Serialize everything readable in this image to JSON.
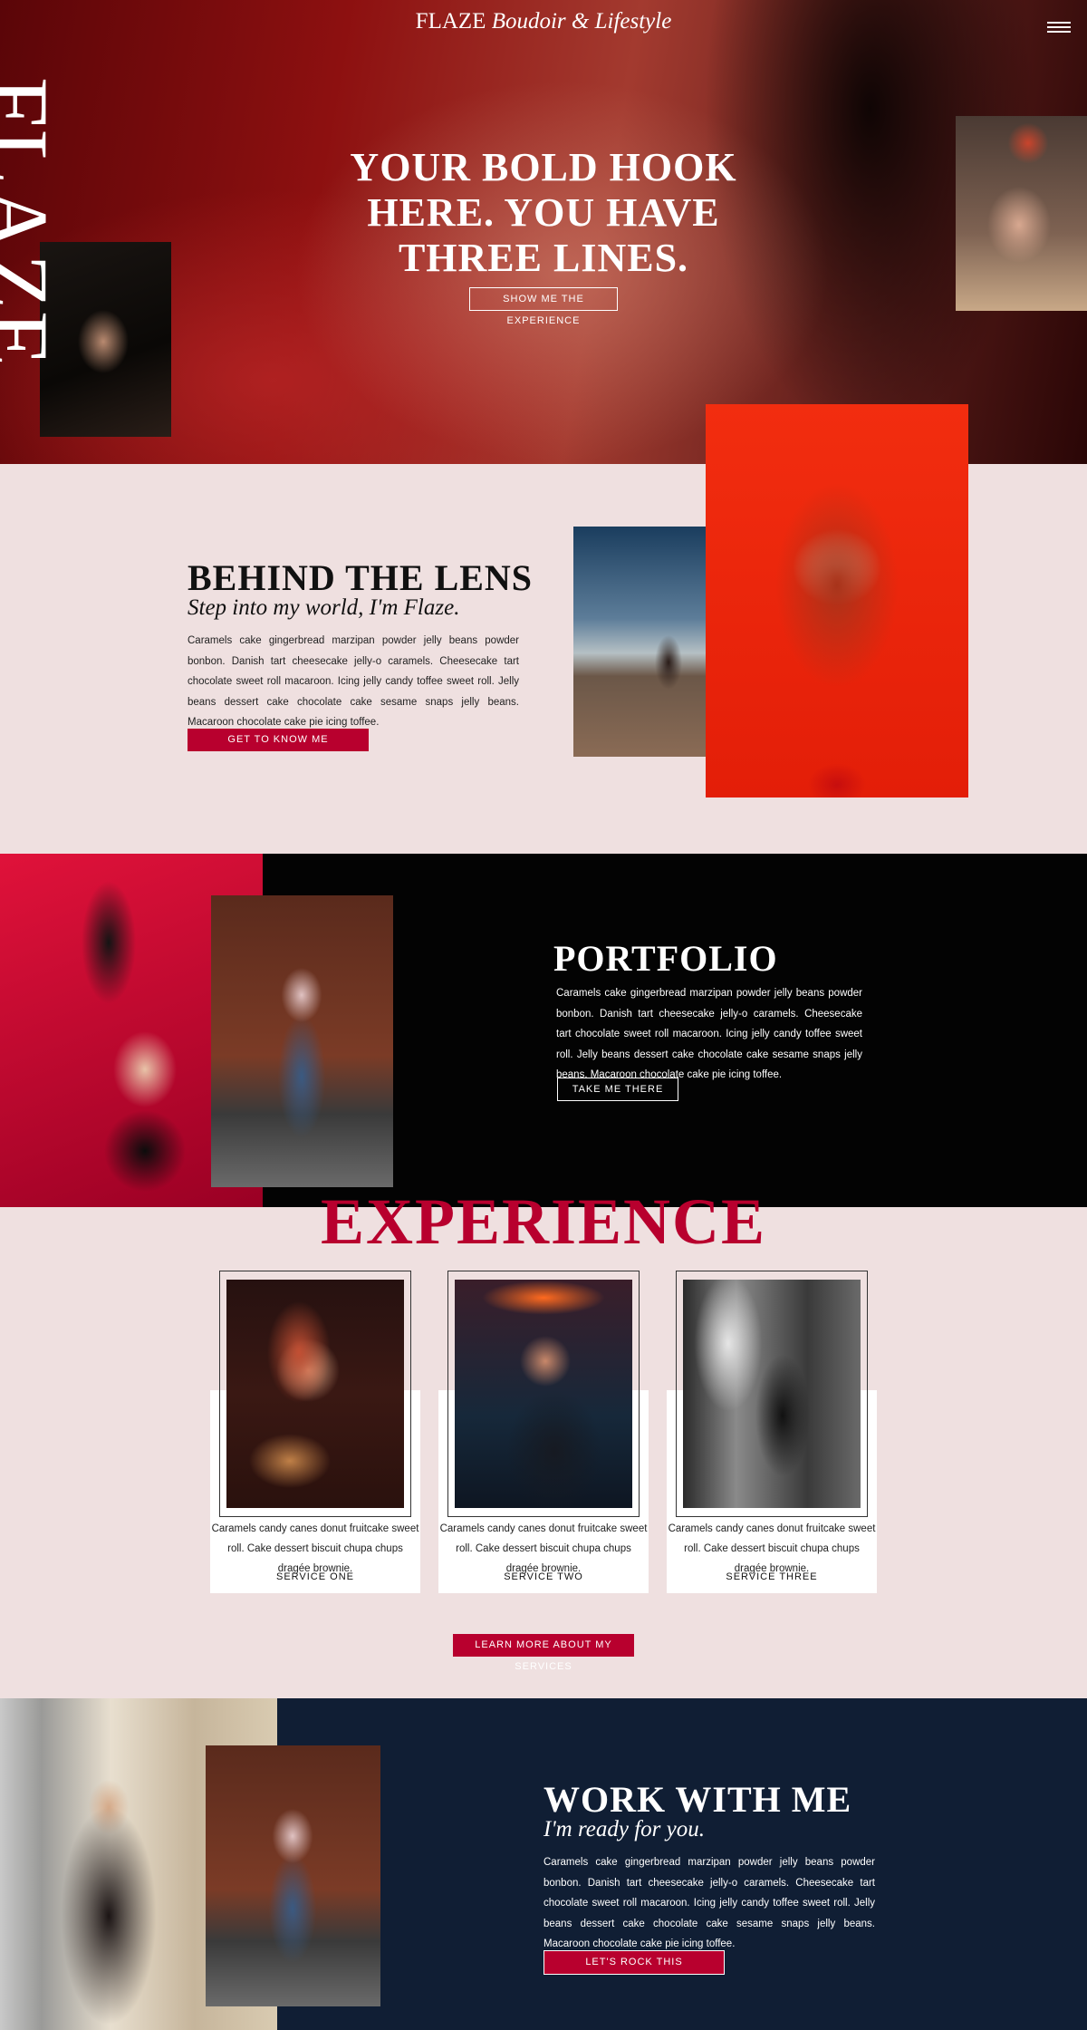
{
  "brand": {
    "name": "FLAZE",
    "tagline": "Boudoir & Lifestyle",
    "vertical_mark": "FLAZE"
  },
  "hero": {
    "headline_lines": [
      "YOUR BOLD HOOK",
      "HERE. YOU HAVE",
      "THREE LINES."
    ],
    "cta": "SHOW ME THE EXPERIENCE"
  },
  "lens": {
    "title": "BEHIND THE LENS",
    "subtitle": "Step into my world, I'm Flaze.",
    "body": "Caramels cake gingerbread marzipan powder jelly beans powder bonbon. Danish tart cheesecake jelly-o caramels. Cheesecake tart chocolate sweet roll macaroon. Icing jelly candy toffee sweet roll. Jelly beans dessert cake chocolate cake sesame snaps jelly beans. Macaroon chocolate cake pie icing toffee.",
    "cta": "GET TO KNOW ME"
  },
  "portfolio": {
    "title": "PORTFOLIO",
    "body": "Caramels cake gingerbread marzipan powder jelly beans powder bonbon. Danish tart cheesecake jelly-o caramels. Cheesecake tart chocolate sweet roll macaroon. Icing jelly candy toffee sweet roll. Jelly beans dessert cake chocolate cake sesame snaps jelly beans. Macaroon chocolate cake pie icing toffee.",
    "cta": "TAKE ME THERE"
  },
  "experience": {
    "title": "EXPERIENCE",
    "services": [
      {
        "text": "Caramels candy canes donut fruitcake sweet roll. Cake dessert biscuit chupa chups dragée brownie.",
        "label": "SERVICE ONE"
      },
      {
        "text": "Caramels candy canes donut fruitcake sweet roll. Cake dessert biscuit chupa chups dragée brownie.",
        "label": "SERVICE TWO"
      },
      {
        "text": "Caramels candy canes donut fruitcake sweet roll. Cake dessert biscuit chupa chups dragée brownie.",
        "label": "SERVICE THREE"
      }
    ],
    "cta": "LEARN MORE ABOUT MY SERVICES"
  },
  "work": {
    "title": "WORK WITH ME",
    "subtitle": "I'm ready for you.",
    "body": "Caramels cake gingerbread marzipan powder jelly beans powder bonbon. Danish tart cheesecake jelly-o caramels. Cheesecake tart chocolate sweet roll macaroon. Icing jelly candy toffee sweet roll. Jelly beans dessert cake chocolate cake sesame snaps jelly beans. Macaroon chocolate cake pie icing toffee.",
    "cta": "LET'S ROCK THIS"
  },
  "colors": {
    "accent": "#b8002e",
    "blush": "#efe0e0",
    "navy": "#101e34",
    "black": "#030303"
  },
  "icons": {
    "menu": "hamburger-menu-icon"
  }
}
